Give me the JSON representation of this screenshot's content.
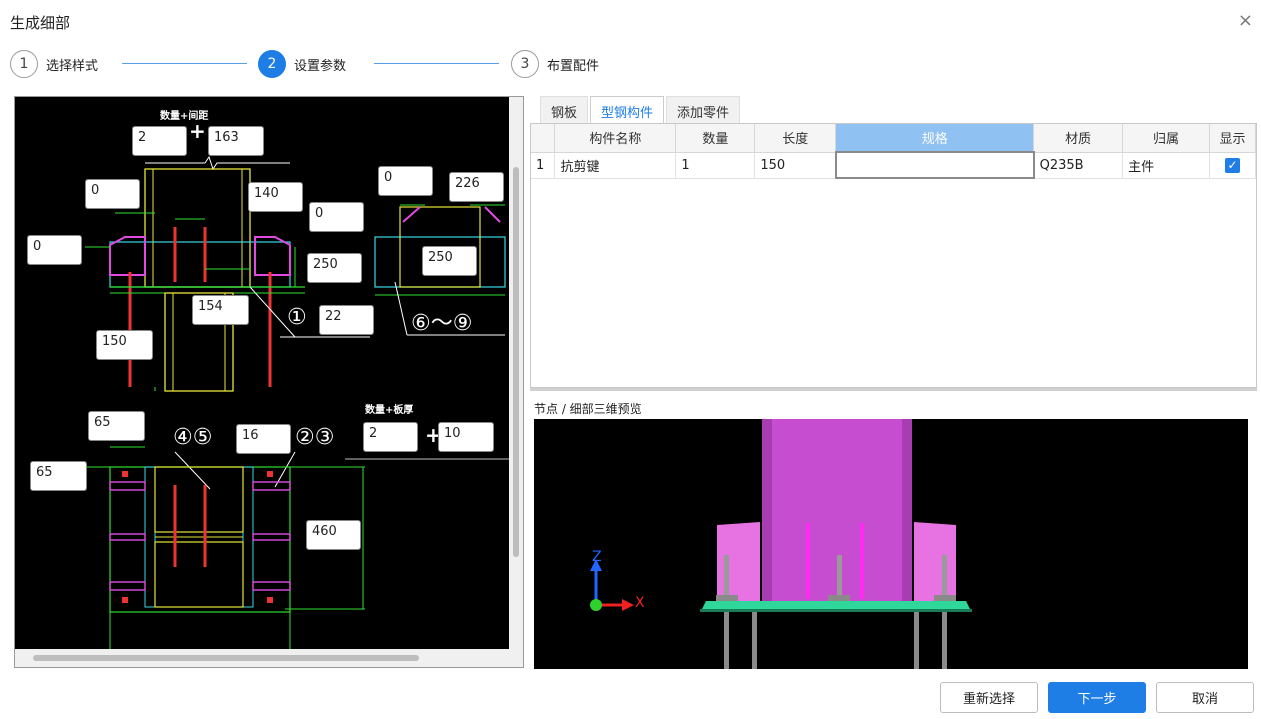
{
  "dialog": {
    "title": "生成细部",
    "close_glyph": "×"
  },
  "steps": [
    {
      "num": "1",
      "label": "选择样式"
    },
    {
      "num": "2",
      "label": "设置参数"
    },
    {
      "num": "3",
      "label": "布置配件"
    }
  ],
  "drawing": {
    "label_qty_spacing": "数量+间距",
    "label_qty_thickness": "数量+板厚",
    "plus": "+",
    "inputs": {
      "qty": "2",
      "spacing": "163",
      "top_offset_left": "0",
      "top_140": "140",
      "left_offset": "0",
      "mid_0": "0",
      "right_0": "0",
      "right_226": "226",
      "left_250": "250",
      "right_250": "250",
      "w154": "154",
      "c22": "22",
      "h150": "150",
      "d65a": "65",
      "d65b": "65",
      "t16": "16",
      "qty2": "2",
      "thk10": "10",
      "h460": "460"
    },
    "callouts": {
      "c1": "①",
      "c6_9": "⑥～⑨",
      "c45": "④⑤",
      "c23": "②③"
    }
  },
  "tabs": [
    "钢板",
    "型钢构件",
    "添加零件"
  ],
  "active_tab": 1,
  "table": {
    "headers": [
      "构件名称",
      "数量",
      "长度",
      "规格",
      "材质",
      "归属",
      "显示"
    ],
    "rows": [
      {
        "idx": "1",
        "name": "抗剪键",
        "qty": "1",
        "length": "150",
        "spec": "",
        "material": "Q235B",
        "owner": "主件",
        "checked": "✓"
      }
    ]
  },
  "preview": {
    "title": "节点 / 细部三维预览",
    "axis_z": "Z",
    "axis_x": "X"
  },
  "buttons": {
    "reselect": "重新选择",
    "next": "下一步",
    "cancel": "取消"
  },
  "colors": {
    "accent": "#1f7de6",
    "column_magenta": "#d65bd6",
    "baseplate_green": "#2fd79a"
  }
}
